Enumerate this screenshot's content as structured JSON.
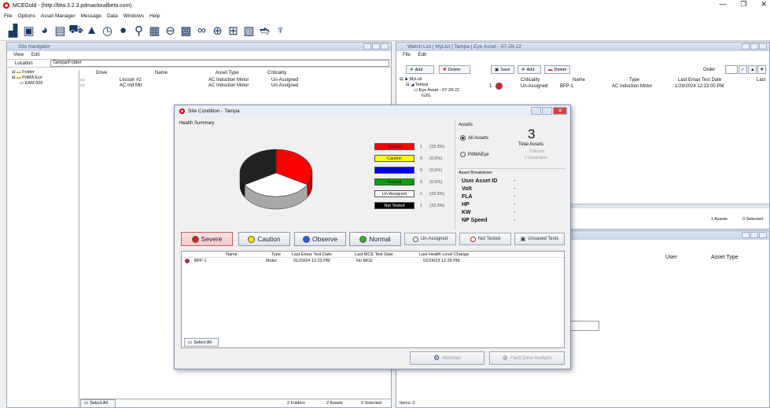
{
  "window": {
    "title": "MCEGold - (http://btw.3.2.3.pdmacloudbeta.com)",
    "min": "—",
    "max": "❐",
    "close": "✕"
  },
  "menu": [
    "File",
    "Options",
    "Asset Manager",
    "Message",
    "Data",
    "Windows",
    "Help"
  ],
  "toolbar_icons": [
    "bar-chart-icon",
    "floppy-icon",
    "pie-icon",
    "db-icon",
    "truck-icon",
    "triangle-icon",
    "clock-icon",
    "test-icon",
    "search-icon",
    "doc-icon",
    "power-icon",
    "calendar-icon",
    "binoculars-icon",
    "target-icon",
    "chart-icon",
    "pdf-icon",
    "export-icon",
    "bulb-icon"
  ],
  "site_navigator": {
    "title": "Site Navigator",
    "menu": [
      "View",
      "Edit"
    ],
    "location_label": "Location",
    "location_value": "Tampa\\Folder",
    "tree": [
      "Folder",
      "PdMA Eye",
      "EAM 009"
    ],
    "columns": [
      "Drive",
      "Name",
      "Asset Type",
      "Criticality"
    ],
    "rows": [
      {
        "name": "Lesson #2",
        "type": "AC Induction Motor",
        "crit": "Un-Assigned"
      },
      {
        "name": "AC Ind Mtr",
        "type": "AC Induction Motor",
        "crit": "Un-Assigned"
      }
    ],
    "select_all": "Select All",
    "status": {
      "folders": "2 Folders",
      "assets": "2 Assets",
      "selected": "0 Selected"
    }
  },
  "watch_list": {
    "title": "Watch List | MyList | Tampa | Eye Asset - 07-28-22",
    "menu": [
      "File",
      "Edit"
    ],
    "add": "Add",
    "delete": "Delete",
    "save": "Save",
    "add2": "Add",
    "delete2": "Delete",
    "order": "Order",
    "tree": [
      "MyList",
      "Tampa",
      "Eye Asset - 07-28-22",
      "G3G"
    ],
    "columns": [
      "Criticality",
      "Name",
      "Type",
      "Last Emax Test Date",
      "Last"
    ],
    "row": {
      "num": "1",
      "crit": "Un-Assigned",
      "name": "BFP-1",
      "type": "AC Induction Motor",
      "date": "1/29/2024 12:23:00 PM"
    },
    "status": {
      "assets": "1 Assets",
      "selected": "0 Selected"
    }
  },
  "lower_panel": {
    "columns": [
      "User",
      "Asset Type"
    ],
    "items": "Items: 0"
  },
  "dialog": {
    "title": "Site Condition - Tampa",
    "health_summary": "Health Summary",
    "legend": [
      {
        "label": "Severe",
        "count": "1",
        "pct": "(33.3%)",
        "bg": "#ff0000",
        "fg": "#111"
      },
      {
        "label": "Caution",
        "count": "0",
        "pct": "(0.0%)",
        "bg": "#ffff00",
        "fg": "#111"
      },
      {
        "label": "Observe",
        "count": "0",
        "pct": "(0.0%)",
        "bg": "#0000ff",
        "fg": "#111"
      },
      {
        "label": "Normal",
        "count": "0",
        "pct": "(0.0%)",
        "bg": "#00a000",
        "fg": "#111"
      },
      {
        "label": "Un-Assigned",
        "count": "1",
        "pct": "(33.3%)",
        "bg": "#ffffff",
        "fg": "#111"
      },
      {
        "label": "Not Tested",
        "count": "1",
        "pct": "(33.3%)",
        "bg": "#000000",
        "fg": "#ffffff"
      }
    ],
    "assets_label": "Assets",
    "all_assets": "All Assets",
    "pdmaeye": "PdMAEye",
    "total_count": "3",
    "total_assets": "Total Assets",
    "motors": "3 Motors",
    "generators": "0 Generators",
    "breakdown_label": "Asset Breakdown",
    "breakdown": [
      {
        "k": "User Asset ID",
        "v": "-"
      },
      {
        "k": "Volt",
        "v": "-"
      },
      {
        "k": "FLA",
        "v": "-"
      },
      {
        "k": "HP",
        "v": "-"
      },
      {
        "k": "KW",
        "v": "-"
      },
      {
        "k": "NP Speed",
        "v": "-"
      }
    ],
    "filters": [
      {
        "label": "Severe",
        "color": "#e02020"
      },
      {
        "label": "Caution",
        "color": "#f5e400"
      },
      {
        "label": "Observe",
        "color": "#2060e0"
      },
      {
        "label": "Normal",
        "color": "#30b030"
      }
    ],
    "unassigned_btn": "Un-Assigned",
    "not_tested_btn": "Not Tested",
    "unsaved_btn": "Unsaved Tests",
    "columns": [
      "Name",
      "Type",
      "Last Emax Test Date",
      "Last MCE Test Date",
      "Last Health Level Change"
    ],
    "row": {
      "name": "BFP-1",
      "type": "Motor",
      "emax": "01/29/24 12:23 PM",
      "mce": "No MCE",
      "change": "02/24/23 12:29 PM"
    },
    "select_all": "Select All",
    "historian": "Historian",
    "fault_zone": "Fault Zone Analysis"
  },
  "chart_data": {
    "type": "pie",
    "categories": [
      "Severe",
      "Caution",
      "Observe",
      "Normal",
      "Un-Assigned",
      "Not Tested"
    ],
    "values": [
      1,
      0,
      0,
      0,
      1,
      1
    ],
    "colors": [
      "#ff0000",
      "#ffff00",
      "#0000ff",
      "#00a000",
      "#ffffff",
      "#222222"
    ]
  }
}
